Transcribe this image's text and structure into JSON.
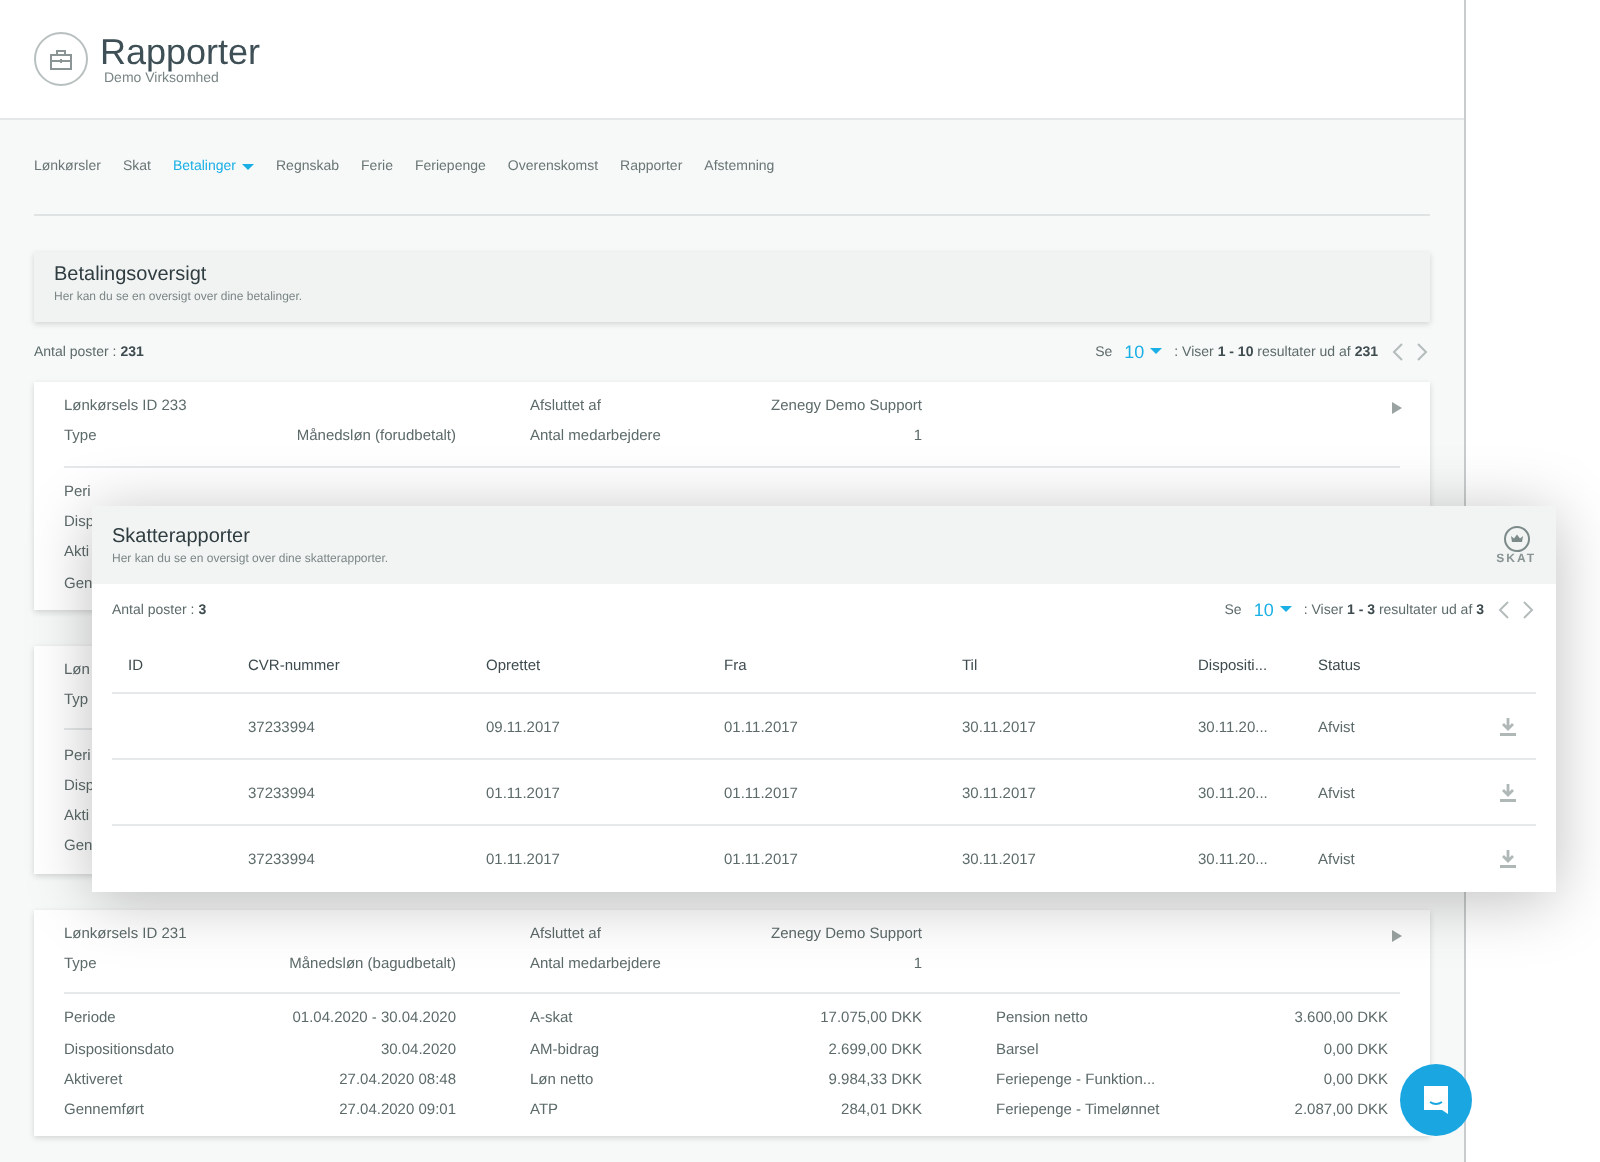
{
  "header": {
    "title": "Rapporter",
    "subtitle": "Demo Virksomhed"
  },
  "nav": [
    {
      "label": "Lønkørsler",
      "selected": false,
      "has_menu": false
    },
    {
      "label": "Skat",
      "selected": false,
      "has_menu": false
    },
    {
      "label": "Betalinger",
      "selected": true,
      "has_menu": true
    },
    {
      "label": "Regnskab",
      "selected": false,
      "has_menu": false
    },
    {
      "label": "Ferie",
      "selected": false,
      "has_menu": false
    },
    {
      "label": "Feriepenge",
      "selected": false,
      "has_menu": false
    },
    {
      "label": "Overenskomst",
      "selected": false,
      "has_menu": false
    },
    {
      "label": "Rapporter",
      "selected": false,
      "has_menu": false
    },
    {
      "label": "Afstemning",
      "selected": false,
      "has_menu": false
    }
  ],
  "overview": {
    "title": "Betalingsoversigt",
    "description": "Her kan du se en oversigt over dine betalinger."
  },
  "count": "Antal poster : **231**",
  "pagination": {
    "label": "Se",
    "page_size": "10",
    "summary": ": Viser **1 - 10** resultater ud af **231**"
  },
  "cards": [
    {
      "header_rows": [
        [
          {
            "label": "Lønkørsels ID 233"
          },
          {
            "label": "Afsluttet af",
            "value": "Zenegy Demo Support"
          }
        ],
        [
          {
            "label": "Type",
            "value": "Månedsløn (forudbetalt)"
          },
          {
            "label": "Antal medarbejdere",
            "value": "1"
          }
        ]
      ],
      "detail_rows": [
        [
          {
            "label": "Peri"
          }
        ],
        [
          {
            "label": "Disp"
          }
        ],
        [
          {
            "label": "Akti"
          }
        ],
        [
          {
            "label": "Gen"
          }
        ]
      ]
    },
    {
      "header_rows": [
        [
          {
            "label": "Løn"
          }
        ],
        [
          {
            "label": "Typ"
          }
        ]
      ],
      "detail_rows": [
        [
          {
            "label": "Peri"
          }
        ],
        [
          {
            "label": "Disp"
          }
        ],
        [
          {
            "label": "Akti"
          }
        ],
        [
          {
            "label": "Gen"
          }
        ]
      ]
    },
    {
      "header_rows": [
        [
          {
            "label": "Lønkørsels ID 231"
          },
          {
            "label": "Afsluttet af",
            "value": "Zenegy Demo Support"
          }
        ],
        [
          {
            "label": "Type",
            "value": "Månedsløn (bagudbetalt)"
          },
          {
            "label": "Antal medarbejdere",
            "value": "1"
          }
        ]
      ],
      "detail_rows": [
        [
          {
            "label": "Periode",
            "value": "01.04.2020 - 30.04.2020"
          },
          {
            "label": "A-skat",
            "value": "17.075,00 DKK"
          },
          {
            "label": "Pension netto",
            "value": "3.600,00 DKK"
          }
        ],
        [
          {
            "label": "Dispositionsdato",
            "value": "30.04.2020"
          },
          {
            "label": "AM-bidrag",
            "value": "2.699,00 DKK"
          },
          {
            "label": "Barsel",
            "value": "0,00 DKK"
          }
        ],
        [
          {
            "label": "Aktiveret",
            "value": "27.04.2020 08:48"
          },
          {
            "label": "Løn netto",
            "value": "9.984,33 DKK"
          },
          {
            "label": "Feriepenge - Funktion...",
            "value": "0,00 DKK"
          }
        ],
        [
          {
            "label": "Gennemført",
            "value": "27.04.2020 09:01"
          },
          {
            "label": "ATP",
            "value": "284,01 DKK"
          },
          {
            "label": "Feriepenge - Timelønnet",
            "value": "2.087,00 DKK"
          }
        ]
      ]
    }
  ],
  "dialog": {
    "title": "Skatterapporter",
    "description": "Her kan du se en oversigt over dine skatterapporter.",
    "logo_text": "SKAT",
    "count": "Antal poster : **3**",
    "pagination": {
      "label": "Se",
      "page_size": "10",
      "summary": ": Viser **1 - 3** resultater ud af **3**"
    },
    "columns": [
      "ID",
      "CVR-nummer",
      "Oprettet",
      "Fra",
      "Til",
      "Dispositi...",
      "Status"
    ],
    "rows": [
      {
        "cells": [
          "",
          "37233994",
          "09.11.2017",
          "01.11.2017",
          "30.11.2017",
          "30.11.20...",
          "Afvist"
        ]
      },
      {
        "cells": [
          "",
          "37233994",
          "01.11.2017",
          "01.11.2017",
          "30.11.2017",
          "30.11.20...",
          "Afvist"
        ]
      },
      {
        "cells": [
          "",
          "37233994",
          "01.11.2017",
          "01.11.2017",
          "30.11.2017",
          "30.11.20...",
          "Afvist"
        ]
      }
    ]
  }
}
